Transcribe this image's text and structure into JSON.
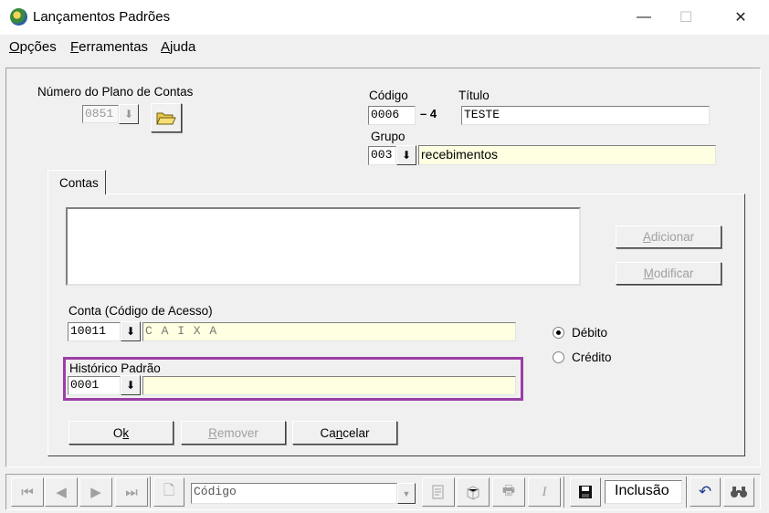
{
  "window": {
    "title": "Lançamentos Padrões",
    "min_glyph": "—",
    "max_glyph": "☐",
    "close_glyph": "✕"
  },
  "menu": {
    "opcoes": {
      "u": "O",
      "rest": "pções"
    },
    "ferramentas": {
      "u": "F",
      "rest": "erramentas"
    },
    "ajuda": {
      "u": "A",
      "rest": "juda"
    }
  },
  "plano": {
    "label": "Número do Plano de Contas",
    "value": "0851",
    "drop_glyph": "⬇"
  },
  "codigo": {
    "label": "Código",
    "value": "0006",
    "suffix": "– 4"
  },
  "titulo": {
    "label": "Título",
    "value": "TESTE"
  },
  "grupo": {
    "label": "Grupo",
    "code": "003",
    "name": "recebimentos",
    "drop_glyph": "⬇"
  },
  "tabs": {
    "contas": "Contas"
  },
  "buttons": {
    "adicionar": {
      "u": "A",
      "rest": "dicionar"
    },
    "modificar": {
      "u": "M",
      "rest": "odificar"
    },
    "ok": {
      "pre": "O",
      "u": "k",
      "rest": ""
    },
    "remover": {
      "pre": "",
      "u": "R",
      "rest": "emover"
    },
    "cancelar": {
      "pre": "Ca",
      "u": "n",
      "rest": "celar"
    }
  },
  "conta": {
    "label": "Conta (Código de Acesso)",
    "code": "10011",
    "name": "C A I X A",
    "drop_glyph": "⬇"
  },
  "tipo": {
    "debito": "Débito",
    "credito": "Crédito",
    "selected": "debito"
  },
  "historico": {
    "label": "Histórico Padrão",
    "code": "0001",
    "text": "",
    "drop_glyph": "⬇"
  },
  "toolbar": {
    "first_glyph": "⏮",
    "prev_glyph": "◀",
    "next_glyph": "▶",
    "last_glyph": "⏭",
    "new_glyph": "🗋",
    "search_field": {
      "placeholder": "Código",
      "drop_glyph": "▼"
    },
    "print_glyph": "🖶",
    "italic_glyph": "I",
    "save_glyph": "💾",
    "mode": "Inclusão",
    "undo_glyph": "↶",
    "find_glyph": "🔍"
  },
  "colors": {
    "highlight": "#9b3ea6",
    "field_yellow": "#ffffe1",
    "accent_blue": "#1a3c8a"
  }
}
